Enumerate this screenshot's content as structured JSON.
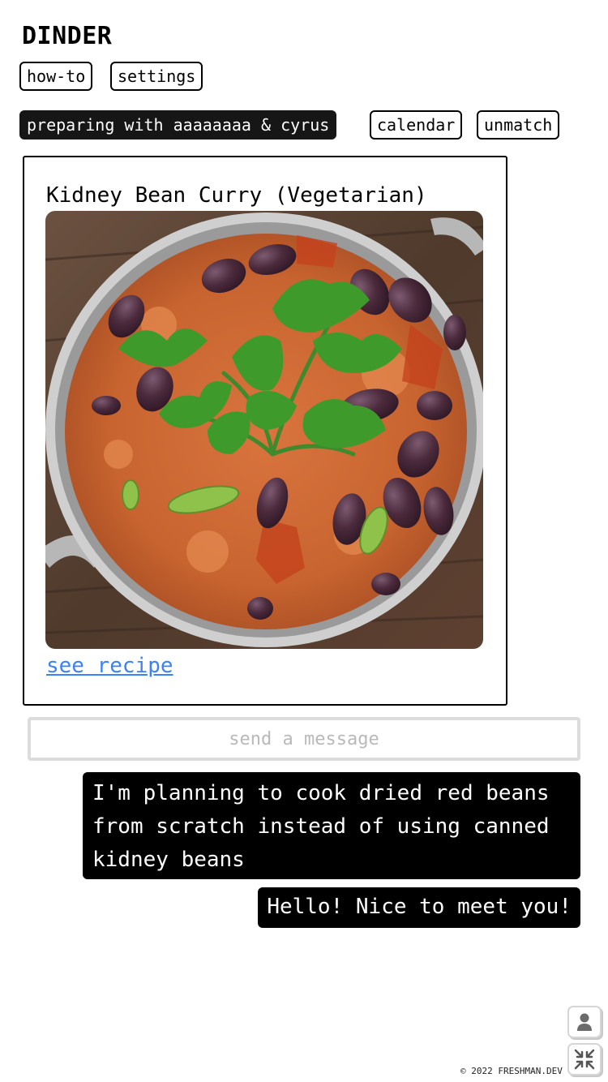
{
  "app": {
    "title": "DINDER"
  },
  "nav": {
    "how_to": "how-to",
    "settings": "settings"
  },
  "match": {
    "status": "preparing with aaaaaaaa & cyrus",
    "calendar": "calendar",
    "unmatch": "unmatch"
  },
  "recipe": {
    "title": "Kidney Bean Curry (Vegetarian)",
    "link_label": "see recipe"
  },
  "chat": {
    "input_placeholder": "send a message",
    "input_value": "",
    "messages": [
      {
        "text": "I'm planning to cook dried red beans from scratch instead of using canned kidney beans"
      },
      {
        "text": "Hello! Nice to meet you!"
      }
    ]
  },
  "corner": {
    "profile_icon": "person-icon",
    "collapse_icon": "collapse-arrows-icon"
  },
  "footer": {
    "copyright": "© 2022 FRESHMAN.DEV"
  },
  "colors": {
    "accent_link": "#3b82f6",
    "dark_pill": "#161616",
    "bubble_bg": "#000000",
    "input_border": "#dcdcdc"
  }
}
